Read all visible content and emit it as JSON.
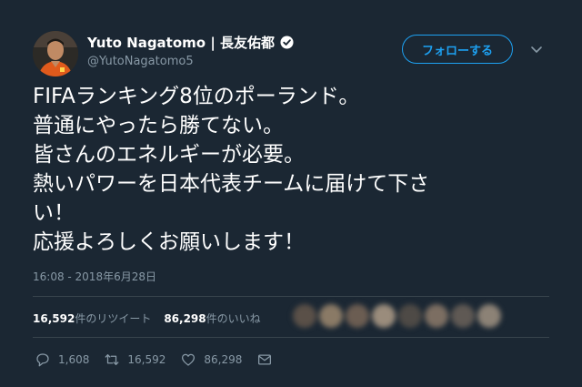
{
  "user": {
    "display_name": "Yuto Nagatomo | 長友佑都",
    "handle": "@YutoNagatomo5",
    "verified": true
  },
  "follow_label": "フォローする",
  "tweet": {
    "lines": [
      "FIFAランキング8位のポーランド。",
      "普通にやったら勝てない。",
      "皆さんのエネルギーが必要。",
      "熱いパワーを日本代表チームに届けて下さ",
      "い！",
      "応援よろしくお願いします！"
    ],
    "timestamp": "16:08 - 2018年6月28日"
  },
  "stats": {
    "retweets_count": "16,592",
    "retweets_label": "件のリツイート",
    "likes_count": "86,298",
    "likes_label": "件のいいね"
  },
  "actions": {
    "reply_count": "1,608",
    "retweet_count": "16,592",
    "like_count": "86,298"
  },
  "colors": {
    "background": "#1b2733",
    "accent": "#1da1f2",
    "muted": "#8899a6",
    "divider": "#38444d"
  },
  "icons": [
    "avatar",
    "verified-badge-icon",
    "chevron-down-icon",
    "reply-icon",
    "retweet-icon",
    "like-icon",
    "message-icon"
  ]
}
